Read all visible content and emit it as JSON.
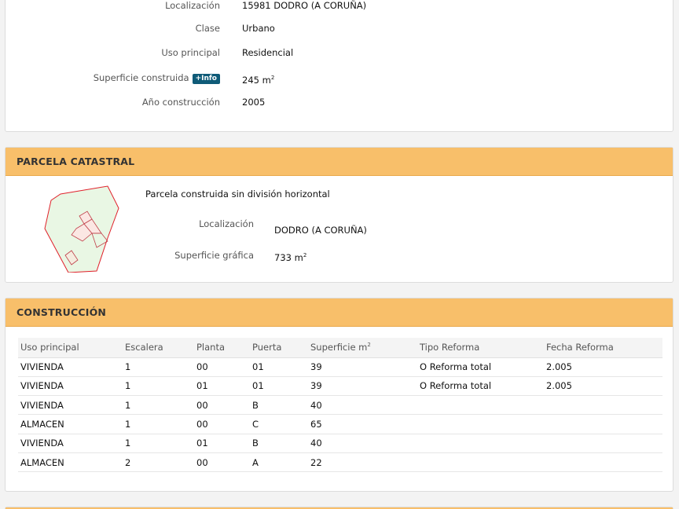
{
  "inmueble": {
    "rows": [
      {
        "label": "Localización",
        "value": "15981 DODRO (A CORUÑA)"
      },
      {
        "label": "Clase",
        "value": "Urbano"
      },
      {
        "label": "Uso principal",
        "value": "Residencial"
      },
      {
        "label": "Superficie construida",
        "badge": "+Info",
        "value": "245 m",
        "unit_sup": "2"
      },
      {
        "label": "Año construcción",
        "value": "2005"
      }
    ]
  },
  "parcela": {
    "title": "PARCELA CATASTRAL",
    "description": "Parcela construida sin división horizontal",
    "localizacion_label": "Localización",
    "localizacion_value": "DODRO (A CORUÑA)",
    "superficie_label": "Superficie gráfica",
    "superficie_value": "733 m",
    "superficie_sup": "2",
    "map_stroke_color": "#e0202a",
    "map_fill_color": "#e9f7e4"
  },
  "construccion": {
    "title": "CONSTRUCCIÓN",
    "headers": [
      "Uso principal",
      "Escalera",
      "Planta",
      "Puerta",
      "Superficie m",
      "Tipo Reforma",
      "Fecha Reforma"
    ],
    "superficie_header_sup": "2",
    "rows": [
      [
        "VIVIENDA",
        "1",
        "00",
        "01",
        "39",
        "O Reforma total",
        "2.005"
      ],
      [
        "VIVIENDA",
        "1",
        "01",
        "01",
        "39",
        "O Reforma total",
        "2.005"
      ],
      [
        "VIVIENDA",
        "1",
        "00",
        "B",
        "40",
        "",
        ""
      ],
      [
        "ALMACEN",
        "1",
        "00",
        "C",
        "65",
        "",
        ""
      ],
      [
        "VIVIENDA",
        "1",
        "01",
        "B",
        "40",
        "",
        ""
      ],
      [
        "ALMACEN",
        "2",
        "00",
        "A",
        "22",
        "",
        ""
      ]
    ]
  },
  "colors": {
    "panel_header_bg": "#f8bf6a",
    "badge_bg": "#0f5b78",
    "page_bg": "#f3f3f3"
  }
}
